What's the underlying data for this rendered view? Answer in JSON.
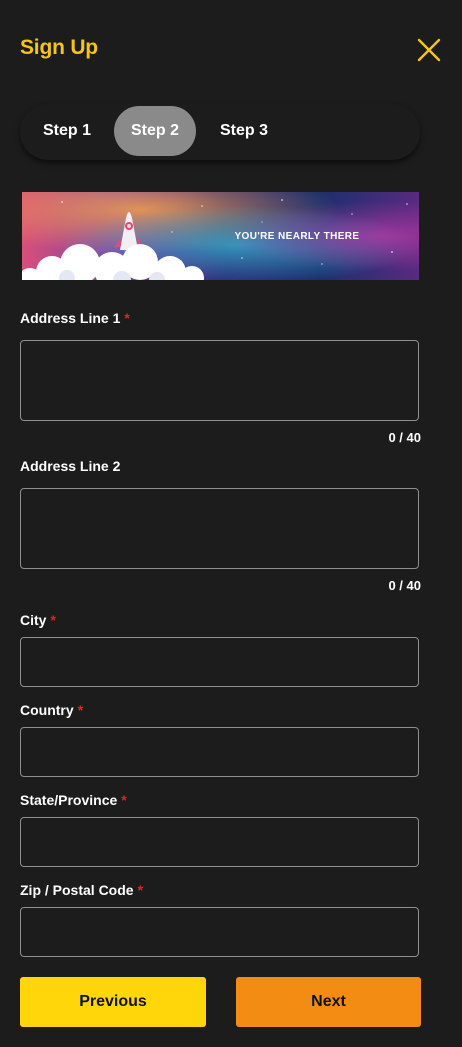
{
  "header": {
    "title": "Sign Up",
    "close_icon": "close-icon"
  },
  "steps": [
    {
      "label": "Step 1",
      "active": false
    },
    {
      "label": "Step 2",
      "active": true
    },
    {
      "label": "Step 3",
      "active": false
    }
  ],
  "banner": {
    "text": "YOU'RE NEARLY THERE",
    "icon": "rocket-icon"
  },
  "form": {
    "address1": {
      "label": "Address Line 1",
      "required": "*",
      "value": "",
      "counter": "0 / 40"
    },
    "address2": {
      "label": "Address Line 2",
      "value": "",
      "counter": "0 / 40"
    },
    "city": {
      "label": "City",
      "required": "*",
      "value": ""
    },
    "country": {
      "label": "Country",
      "required": "*",
      "value": ""
    },
    "state": {
      "label": "State/Province",
      "required": "*",
      "value": ""
    },
    "zip": {
      "label": "Zip / Postal Code",
      "required": "*",
      "value": ""
    }
  },
  "buttons": {
    "previous": "Previous",
    "next": "Next"
  },
  "colors": {
    "accent": "#f5c518",
    "previous_button": "#ffd60a",
    "next_button": "#f28c13",
    "required": "#e02424",
    "active_step": "#8a8a8a",
    "background": "#1c1c1c"
  }
}
